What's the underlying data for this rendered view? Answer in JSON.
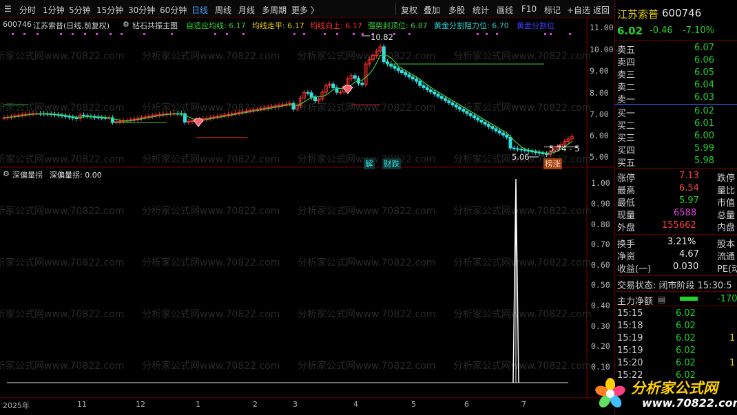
{
  "toolbar": {
    "left_items": [
      "分时",
      "1分钟",
      "5分钟",
      "15分钟",
      "30分钟",
      "60分钟",
      "日线",
      "周线",
      "月线",
      "多周期",
      "更多 〉"
    ],
    "active_item": "日线",
    "right_items": [
      "复权",
      "叠加",
      "多股",
      "统计",
      "画线",
      "F10",
      "标记",
      "+自选",
      "返回"
    ]
  },
  "chart": {
    "code": "600746",
    "title": "江苏索普(日线,前复权)",
    "indicator_name": "钻石共振主图",
    "lines": [
      {
        "label": "自适应均线: 6.17",
        "color": "#3ccc3c"
      },
      {
        "label": "均线走平: 6.17",
        "color": "#e8d000"
      },
      {
        "label": "均线向上: 6.17",
        "color": "#ff3030"
      },
      {
        "label": "强势封顶位: 6.87",
        "color": "#3ccc3c"
      },
      {
        "label": "黄金分割阻力位: 6.70",
        "color": "#30d0d0"
      },
      {
        "label": "黄金分割位",
        "color": "#4040ff"
      }
    ],
    "price_ticks": [
      "11.00",
      "10.00",
      "9.00",
      "8.00",
      "7.00",
      "6.00",
      "5.00"
    ],
    "annotations": {
      "high": "10.82",
      "low": "5.06",
      "range": "5.74 - 5",
      "tag_jie": "解",
      "tag_caidie": "财跌",
      "tag_bangzhang": "榜涨"
    },
    "sub_indicator": {
      "name": "深偏量拐",
      "value_label": "深偏量拐: 0.00"
    },
    "sub_ticks": [
      "1.00",
      "0.90",
      "0.80",
      "0.70",
      "0.60",
      "0.50",
      "0.40",
      "0.30",
      "0.20",
      "0.10"
    ],
    "time_ticks": [
      "2025年",
      "11",
      "12",
      "1",
      "2",
      "3",
      "4",
      "5",
      "6",
      "7"
    ],
    "watermark": "分析家公式网www.70822.com",
    "colors": {
      "up": "#ff3030",
      "down": "#30e0e0",
      "ma": "#3ccc3c",
      "border": "#7a0000"
    }
  },
  "quote": {
    "name": "江苏索普",
    "code": "600746",
    "price": "6.02",
    "change": "-0.46",
    "change_pct": "-7.10%",
    "asks": [
      {
        "label": "卖五",
        "price": "6.07"
      },
      {
        "label": "卖四",
        "price": "6.06"
      },
      {
        "label": "卖三",
        "price": "6.05"
      },
      {
        "label": "卖二",
        "price": "6.04"
      },
      {
        "label": "卖一",
        "price": "6.03"
      }
    ],
    "bids": [
      {
        "label": "买一",
        "price": "6.02"
      },
      {
        "label": "买二",
        "price": "6.01"
      },
      {
        "label": "买三",
        "price": "6.00"
      },
      {
        "label": "买四",
        "price": "5.99"
      },
      {
        "label": "买五",
        "price": "5.98"
      }
    ],
    "stats": [
      {
        "label": "涨停",
        "value": "7.13",
        "label2": "跌停"
      },
      {
        "label": "最高",
        "value": "6.54",
        "label2": "量比"
      },
      {
        "label": "最低",
        "value": "5.97",
        "label2": "市值"
      },
      {
        "label": "现量",
        "value": "6588",
        "label2": "总量"
      },
      {
        "label": "外盘",
        "value": "155662",
        "label2": "内盘"
      }
    ],
    "stats2": [
      {
        "label": "换手",
        "value": "3.21%",
        "label2": "股本"
      },
      {
        "label": "净资",
        "value": "4.67",
        "label2": "流通"
      },
      {
        "label": "收益(一)",
        "value": "0.030",
        "label2": "PE(动)"
      }
    ],
    "trade_state": "交易状态: 闭市阶段 15:30:5",
    "main_flow_label": "主力净额",
    "main_flow_value": "-170",
    "ticks": [
      {
        "time": "15:15",
        "price": "6.02",
        "vol": ""
      },
      {
        "time": "15:18",
        "price": "6.02",
        "vol": ""
      },
      {
        "time": "15:19",
        "price": "6.02",
        "vol": "1"
      },
      {
        "time": "15:19",
        "price": "6.02",
        "vol": ""
      },
      {
        "time": "15:20",
        "price": "6.02",
        "vol": "1"
      },
      {
        "time": "15:22",
        "price": "6.02",
        "vol": ""
      }
    ]
  },
  "logo": {
    "text": "分析家公式网",
    "url": "www.70822.com"
  }
}
